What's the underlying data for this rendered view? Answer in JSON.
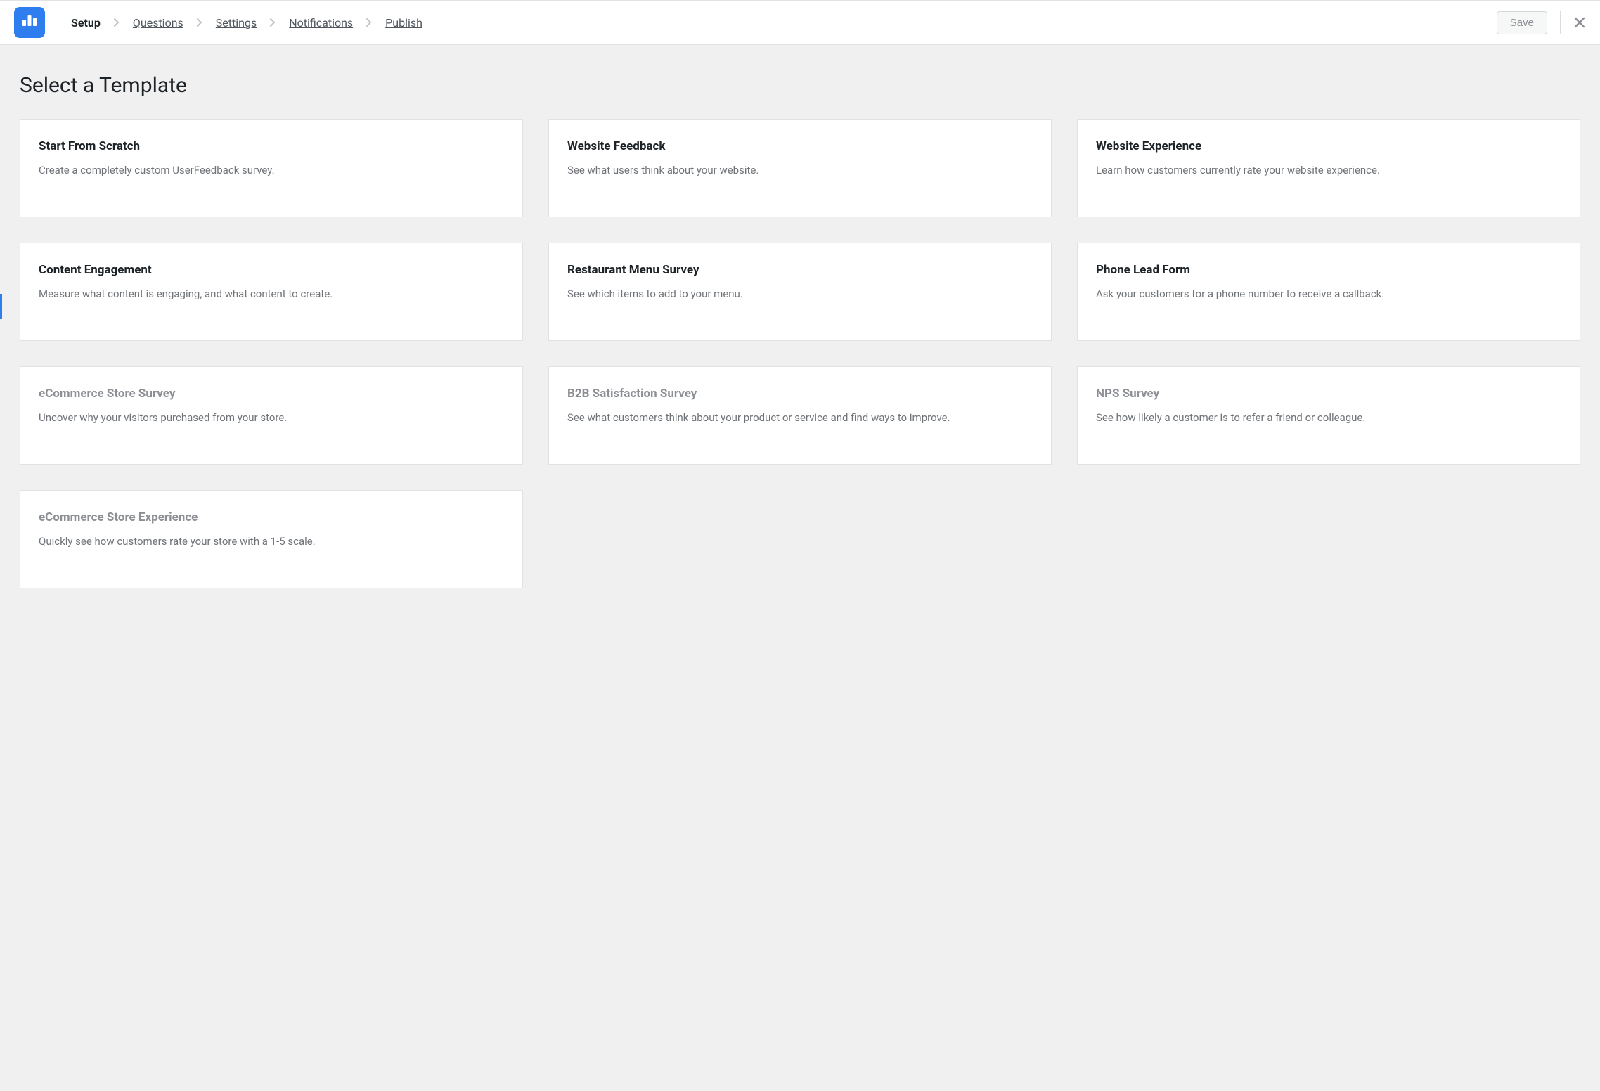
{
  "header": {
    "breadcrumbs": [
      {
        "label": "Setup",
        "active": true
      },
      {
        "label": "Questions",
        "active": false
      },
      {
        "label": "Settings",
        "active": false
      },
      {
        "label": "Notifications",
        "active": false
      },
      {
        "label": "Publish",
        "active": false
      }
    ],
    "save_label": "Save"
  },
  "page": {
    "title": "Select a Template"
  },
  "templates": [
    {
      "title": "Start From Scratch",
      "desc": "Create a completely custom UserFeedback survey.",
      "disabled": false
    },
    {
      "title": "Website Feedback",
      "desc": "See what users think about your website.",
      "disabled": false
    },
    {
      "title": "Website Experience",
      "desc": "Learn how customers currently rate your website experience.",
      "disabled": false
    },
    {
      "title": "Content Engagement",
      "desc": "Measure what content is engaging, and what content to create.",
      "disabled": false
    },
    {
      "title": "Restaurant Menu Survey",
      "desc": "See which items to add to your menu.",
      "disabled": false
    },
    {
      "title": "Phone Lead Form",
      "desc": "Ask your customers for a phone number to receive a callback.",
      "disabled": false
    },
    {
      "title": "eCommerce Store Survey",
      "desc": "Uncover why your visitors purchased from your store.",
      "disabled": true
    },
    {
      "title": "B2B Satisfaction Survey",
      "desc": "See what customers think about your product or service and find ways to improve.",
      "disabled": true
    },
    {
      "title": "NPS Survey",
      "desc": "See how likely a customer is to refer a friend or colleague.",
      "disabled": true
    },
    {
      "title": "eCommerce Store Experience",
      "desc": "Quickly see how customers rate your store with a 1-5 scale.",
      "disabled": true
    }
  ]
}
